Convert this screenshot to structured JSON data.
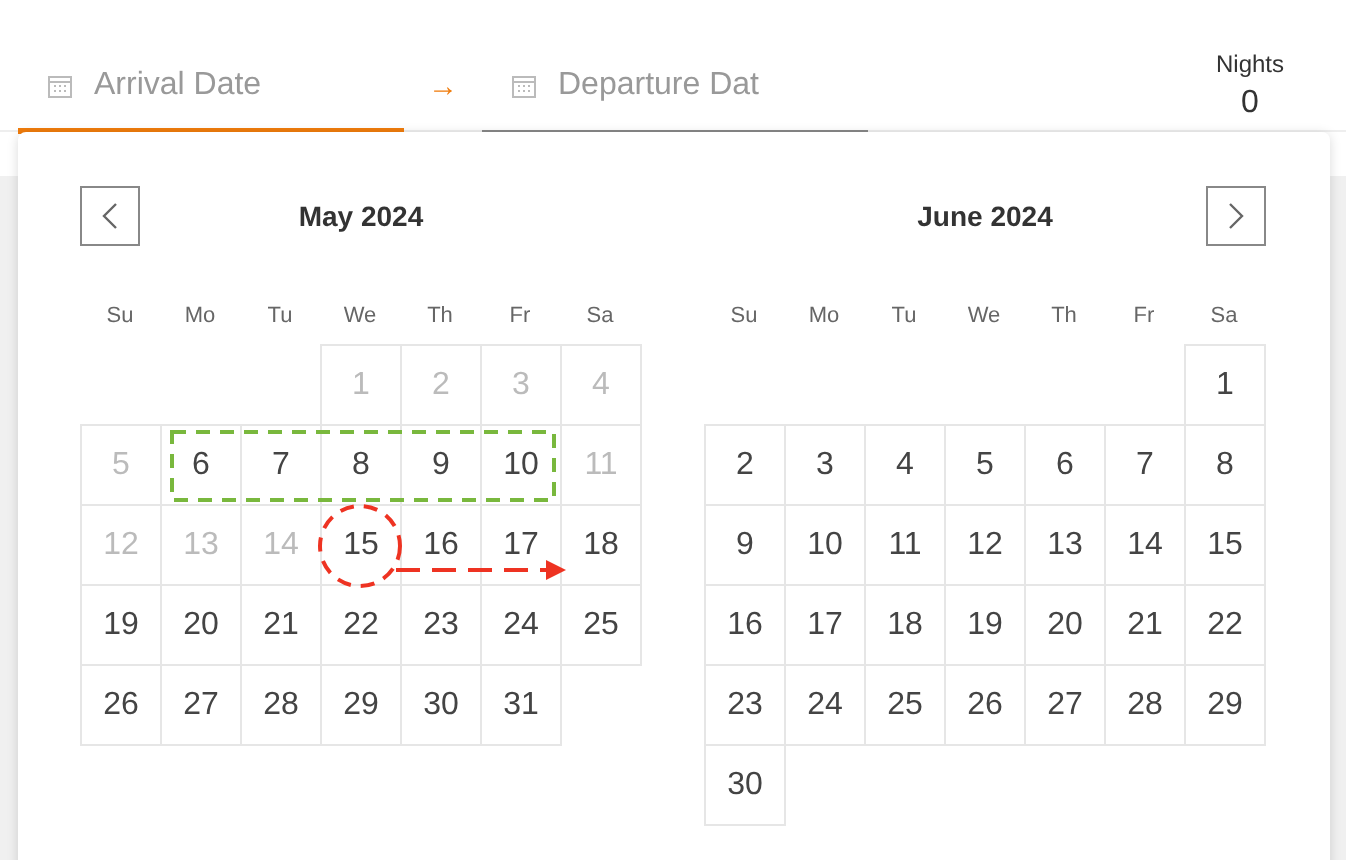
{
  "arrival": {
    "placeholder": "Arrival Date",
    "selected": true
  },
  "arrow": "→",
  "departure": {
    "placeholder": "Departure Dat",
    "selected": false
  },
  "nights": {
    "label": "Nights",
    "value": "0"
  },
  "months": [
    {
      "title": "May 2024",
      "prev": true,
      "next": false,
      "weekdays": [
        "Su",
        "Mo",
        "Tu",
        "We",
        "Th",
        "Fr",
        "Sa"
      ],
      "days": [
        {
          "kind": "empty"
        },
        {
          "kind": "empty"
        },
        {
          "kind": "empty"
        },
        {
          "kind": "day",
          "label": "1",
          "disabled": true
        },
        {
          "kind": "day",
          "label": "2",
          "disabled": true
        },
        {
          "kind": "day",
          "label": "3",
          "disabled": true
        },
        {
          "kind": "day",
          "label": "4",
          "disabled": true
        },
        {
          "kind": "day",
          "label": "5",
          "disabled": true
        },
        {
          "kind": "day",
          "label": "6",
          "disabled": false
        },
        {
          "kind": "day",
          "label": "7",
          "disabled": false
        },
        {
          "kind": "day",
          "label": "8",
          "disabled": false
        },
        {
          "kind": "day",
          "label": "9",
          "disabled": false
        },
        {
          "kind": "day",
          "label": "10",
          "disabled": false
        },
        {
          "kind": "day",
          "label": "11",
          "disabled": true
        },
        {
          "kind": "day",
          "label": "12",
          "disabled": true
        },
        {
          "kind": "day",
          "label": "13",
          "disabled": true
        },
        {
          "kind": "day",
          "label": "14",
          "disabled": true
        },
        {
          "kind": "day",
          "label": "15",
          "disabled": false
        },
        {
          "kind": "day",
          "label": "16",
          "disabled": false
        },
        {
          "kind": "day",
          "label": "17",
          "disabled": false
        },
        {
          "kind": "day",
          "label": "18",
          "disabled": false
        },
        {
          "kind": "day",
          "label": "19",
          "disabled": false
        },
        {
          "kind": "day",
          "label": "20",
          "disabled": false
        },
        {
          "kind": "day",
          "label": "21",
          "disabled": false
        },
        {
          "kind": "day",
          "label": "22",
          "disabled": false
        },
        {
          "kind": "day",
          "label": "23",
          "disabled": false
        },
        {
          "kind": "day",
          "label": "24",
          "disabled": false
        },
        {
          "kind": "day",
          "label": "25",
          "disabled": false
        },
        {
          "kind": "day",
          "label": "26",
          "disabled": false
        },
        {
          "kind": "day",
          "label": "27",
          "disabled": false
        },
        {
          "kind": "day",
          "label": "28",
          "disabled": false
        },
        {
          "kind": "day",
          "label": "29",
          "disabled": false
        },
        {
          "kind": "day",
          "label": "30",
          "disabled": false
        },
        {
          "kind": "day",
          "label": "31",
          "disabled": false
        }
      ]
    },
    {
      "title": "June 2024",
      "prev": false,
      "next": true,
      "weekdays": [
        "Su",
        "Mo",
        "Tu",
        "We",
        "Th",
        "Fr",
        "Sa"
      ],
      "days": [
        {
          "kind": "empty"
        },
        {
          "kind": "empty"
        },
        {
          "kind": "empty"
        },
        {
          "kind": "empty"
        },
        {
          "kind": "empty"
        },
        {
          "kind": "empty"
        },
        {
          "kind": "day",
          "label": "1",
          "disabled": false
        },
        {
          "kind": "day",
          "label": "2",
          "disabled": false
        },
        {
          "kind": "day",
          "label": "3",
          "disabled": false
        },
        {
          "kind": "day",
          "label": "4",
          "disabled": false
        },
        {
          "kind": "day",
          "label": "5",
          "disabled": false
        },
        {
          "kind": "day",
          "label": "6",
          "disabled": false
        },
        {
          "kind": "day",
          "label": "7",
          "disabled": false
        },
        {
          "kind": "day",
          "label": "8",
          "disabled": false
        },
        {
          "kind": "day",
          "label": "9",
          "disabled": false
        },
        {
          "kind": "day",
          "label": "10",
          "disabled": false
        },
        {
          "kind": "day",
          "label": "11",
          "disabled": false
        },
        {
          "kind": "day",
          "label": "12",
          "disabled": false
        },
        {
          "kind": "day",
          "label": "13",
          "disabled": false
        },
        {
          "kind": "day",
          "label": "14",
          "disabled": false
        },
        {
          "kind": "day",
          "label": "15",
          "disabled": false
        },
        {
          "kind": "day",
          "label": "16",
          "disabled": false
        },
        {
          "kind": "day",
          "label": "17",
          "disabled": false
        },
        {
          "kind": "day",
          "label": "18",
          "disabled": false
        },
        {
          "kind": "day",
          "label": "19",
          "disabled": false
        },
        {
          "kind": "day",
          "label": "20",
          "disabled": false
        },
        {
          "kind": "day",
          "label": "21",
          "disabled": false
        },
        {
          "kind": "day",
          "label": "22",
          "disabled": false
        },
        {
          "kind": "day",
          "label": "23",
          "disabled": false
        },
        {
          "kind": "day",
          "label": "24",
          "disabled": false
        },
        {
          "kind": "day",
          "label": "25",
          "disabled": false
        },
        {
          "kind": "day",
          "label": "26",
          "disabled": false
        },
        {
          "kind": "day",
          "label": "27",
          "disabled": false
        },
        {
          "kind": "day",
          "label": "28",
          "disabled": false
        },
        {
          "kind": "day",
          "label": "29",
          "disabled": false
        },
        {
          "kind": "day",
          "label": "30",
          "disabled": false
        }
      ]
    }
  ]
}
